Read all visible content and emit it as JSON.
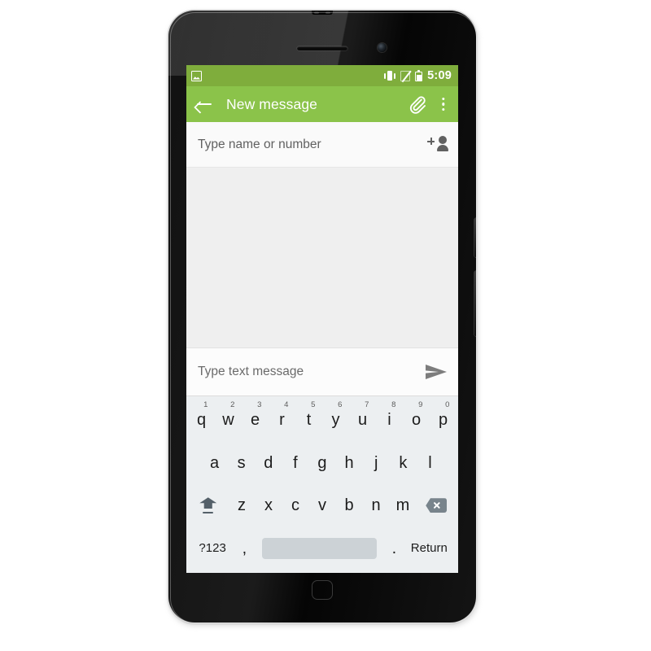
{
  "device": {
    "hardware": {
      "earpiece": "earpiece-speaker",
      "front_camera": "front-camera",
      "home_button": "home-button",
      "power_key": "power-key",
      "volume_key": "volume-key"
    }
  },
  "status_bar": {
    "background_color": "#7fad3c",
    "notification_icon": "photo-icon",
    "icons": [
      "vibrate-icon",
      "no-signal-icon",
      "battery-icon"
    ],
    "time": "5:09"
  },
  "action_bar": {
    "background_color": "#8bc34a",
    "back_icon": "back-arrow-icon",
    "title": "New message",
    "attach_icon": "paperclip-icon",
    "overflow_icon": "overflow-menu-icon"
  },
  "recipient": {
    "placeholder": "Type name or number",
    "value": "",
    "add_contact_icon": "add-person-icon"
  },
  "compose": {
    "placeholder": "Type text message",
    "value": "",
    "send_icon": "send-icon"
  },
  "keyboard": {
    "row1": [
      {
        "key": "q",
        "num": "1"
      },
      {
        "key": "w",
        "num": "2"
      },
      {
        "key": "e",
        "num": "3"
      },
      {
        "key": "r",
        "num": "4"
      },
      {
        "key": "t",
        "num": "5"
      },
      {
        "key": "y",
        "num": "6"
      },
      {
        "key": "u",
        "num": "7"
      },
      {
        "key": "i",
        "num": "8"
      },
      {
        "key": "o",
        "num": "9"
      },
      {
        "key": "p",
        "num": "0"
      }
    ],
    "row2": [
      "a",
      "s",
      "d",
      "f",
      "g",
      "h",
      "j",
      "k",
      "l"
    ],
    "row3": {
      "shift_icon": "shift-icon",
      "letters": [
        "z",
        "x",
        "c",
        "v",
        "b",
        "n",
        "m"
      ],
      "backspace_icon": "backspace-icon"
    },
    "row4": {
      "symbols_label": "?123",
      "comma": ",",
      "space": "",
      "period": ".",
      "return_label": "Return"
    }
  }
}
